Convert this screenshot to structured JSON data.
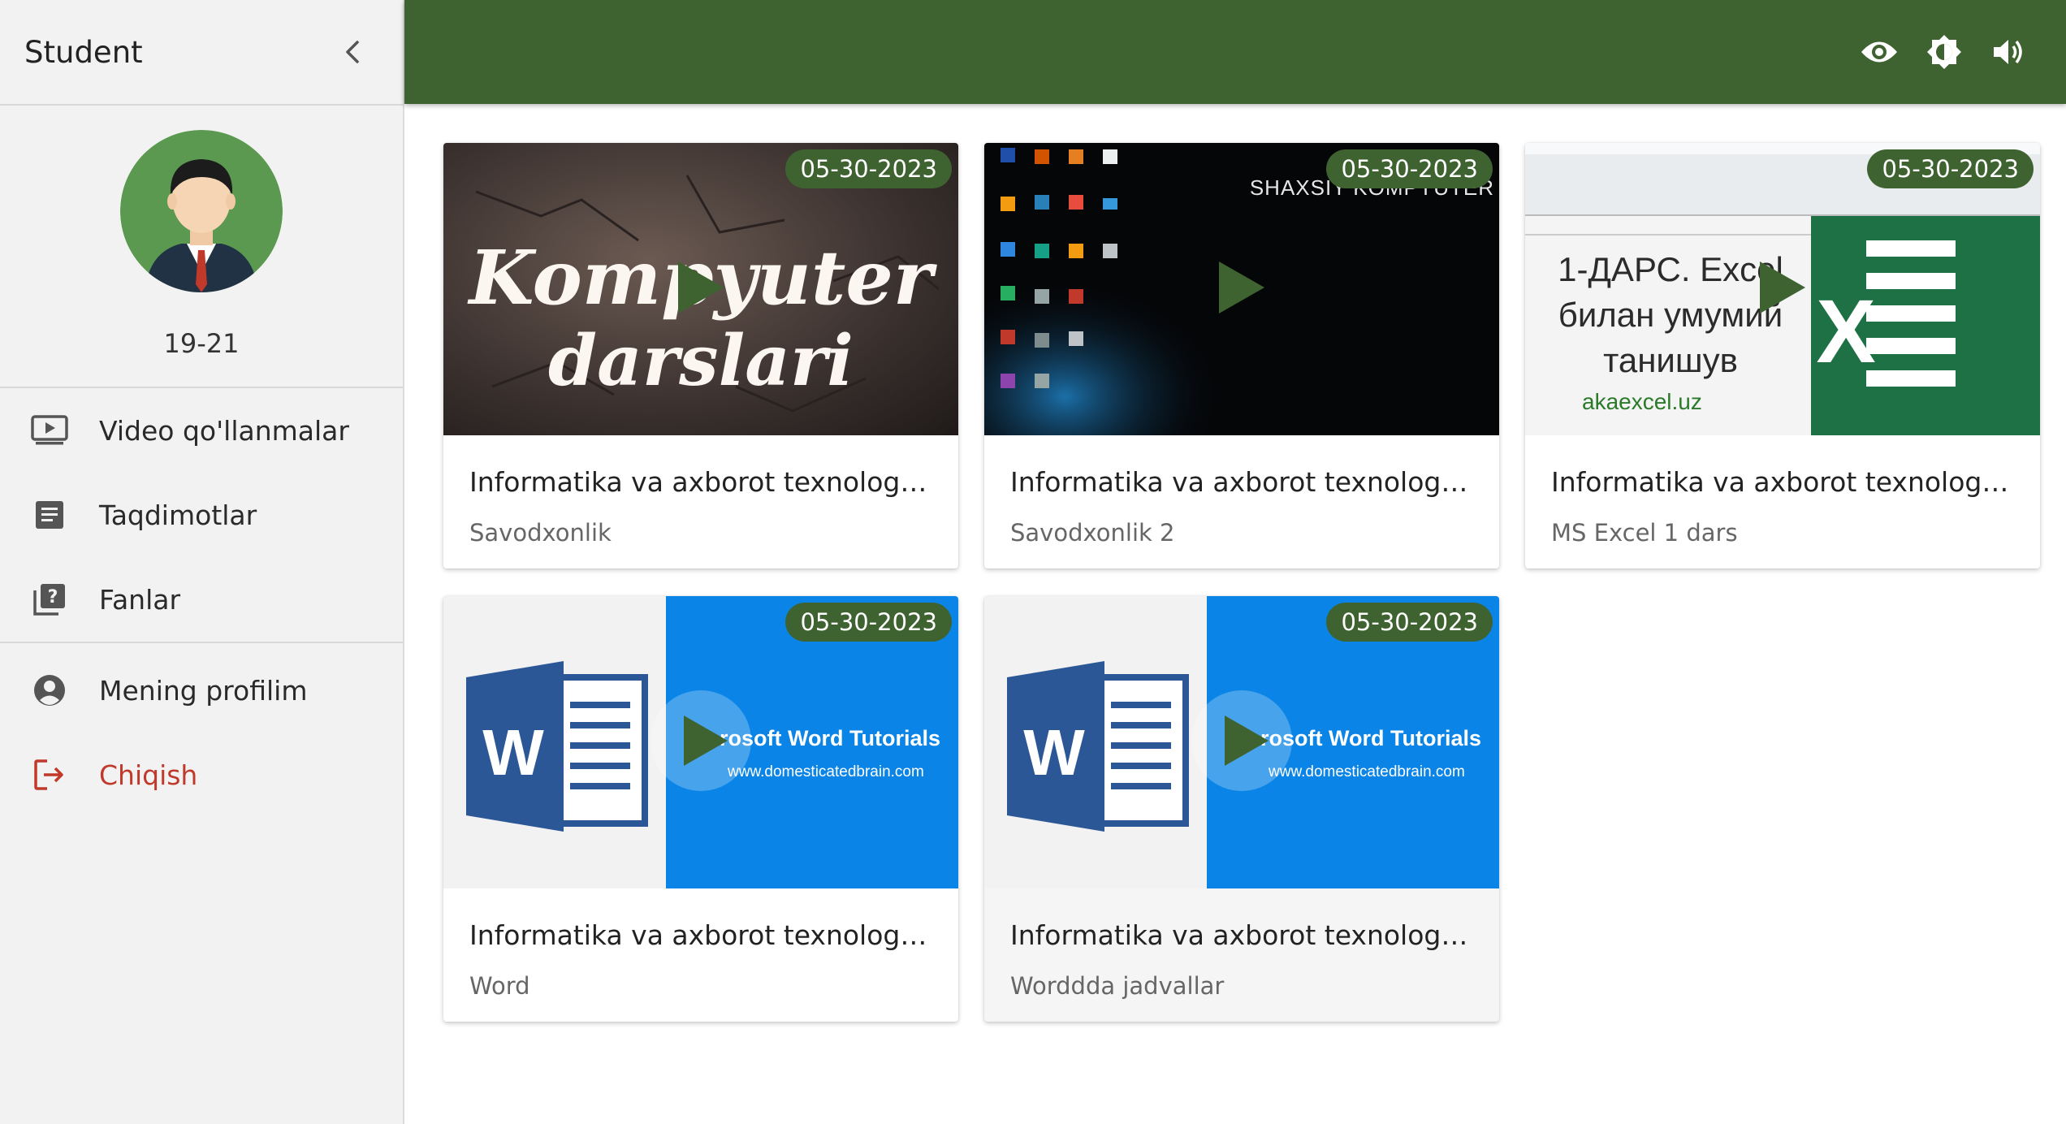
{
  "sidebar": {
    "title": "Student",
    "collapse_icon": "chevron-left-icon",
    "group": "19-21",
    "nav_primary": [
      {
        "label": "Video qo'llanmalar",
        "icon": "video-play-icon"
      },
      {
        "label": "Taqdimotlar",
        "icon": "document-icon"
      },
      {
        "label": "Fanlar",
        "icon": "quiz-icon"
      }
    ],
    "nav_secondary": [
      {
        "label": "Mening profilim",
        "icon": "account-circle-icon"
      },
      {
        "label": "Chiqish",
        "icon": "logout-icon"
      }
    ]
  },
  "topbar": {
    "icons": [
      "eye-icon",
      "brightness-icon",
      "volume-icon"
    ],
    "color": "#3f6330"
  },
  "cards": [
    {
      "date": "05-30-2023",
      "title": "Informatika va axborot texnologiya...",
      "subtitle": "Savodxonlik",
      "thumb_text": [
        "Kompyuter",
        "darslari"
      ]
    },
    {
      "date": "05-30-2023",
      "title": "Informatika va axborot texnologiya...",
      "subtitle": "Savodxonlik 2",
      "thumb_text": [
        "SHAXSIY KOMPYUTER"
      ]
    },
    {
      "date": "05-30-2023",
      "title": "Informatika va axborot texnologiya...",
      "subtitle": "MS Excel 1 dars",
      "thumb_text": [
        "1-ДАРС. Excel",
        "билан умумий",
        "танишув",
        "akaexcel.uz"
      ]
    },
    {
      "date": "05-30-2023",
      "title": "Informatika va axborot texnologiya...",
      "subtitle": "Word",
      "thumb_text": [
        "rosoft Word Tutorials",
        "www.domesticatedbrain.com"
      ]
    },
    {
      "date": "05-30-2023",
      "title": "Informatika va axborot texnologiya...",
      "subtitle": "Worddda jadvallar",
      "thumb_text": [
        "rosoft Word Tutorials",
        "www.domesticatedbrain.com"
      ]
    }
  ],
  "colors": {
    "accent": "#3f6330",
    "logout": "#c0392b",
    "word_blue": "#0a84e6",
    "excel_green": "#1e7145"
  }
}
